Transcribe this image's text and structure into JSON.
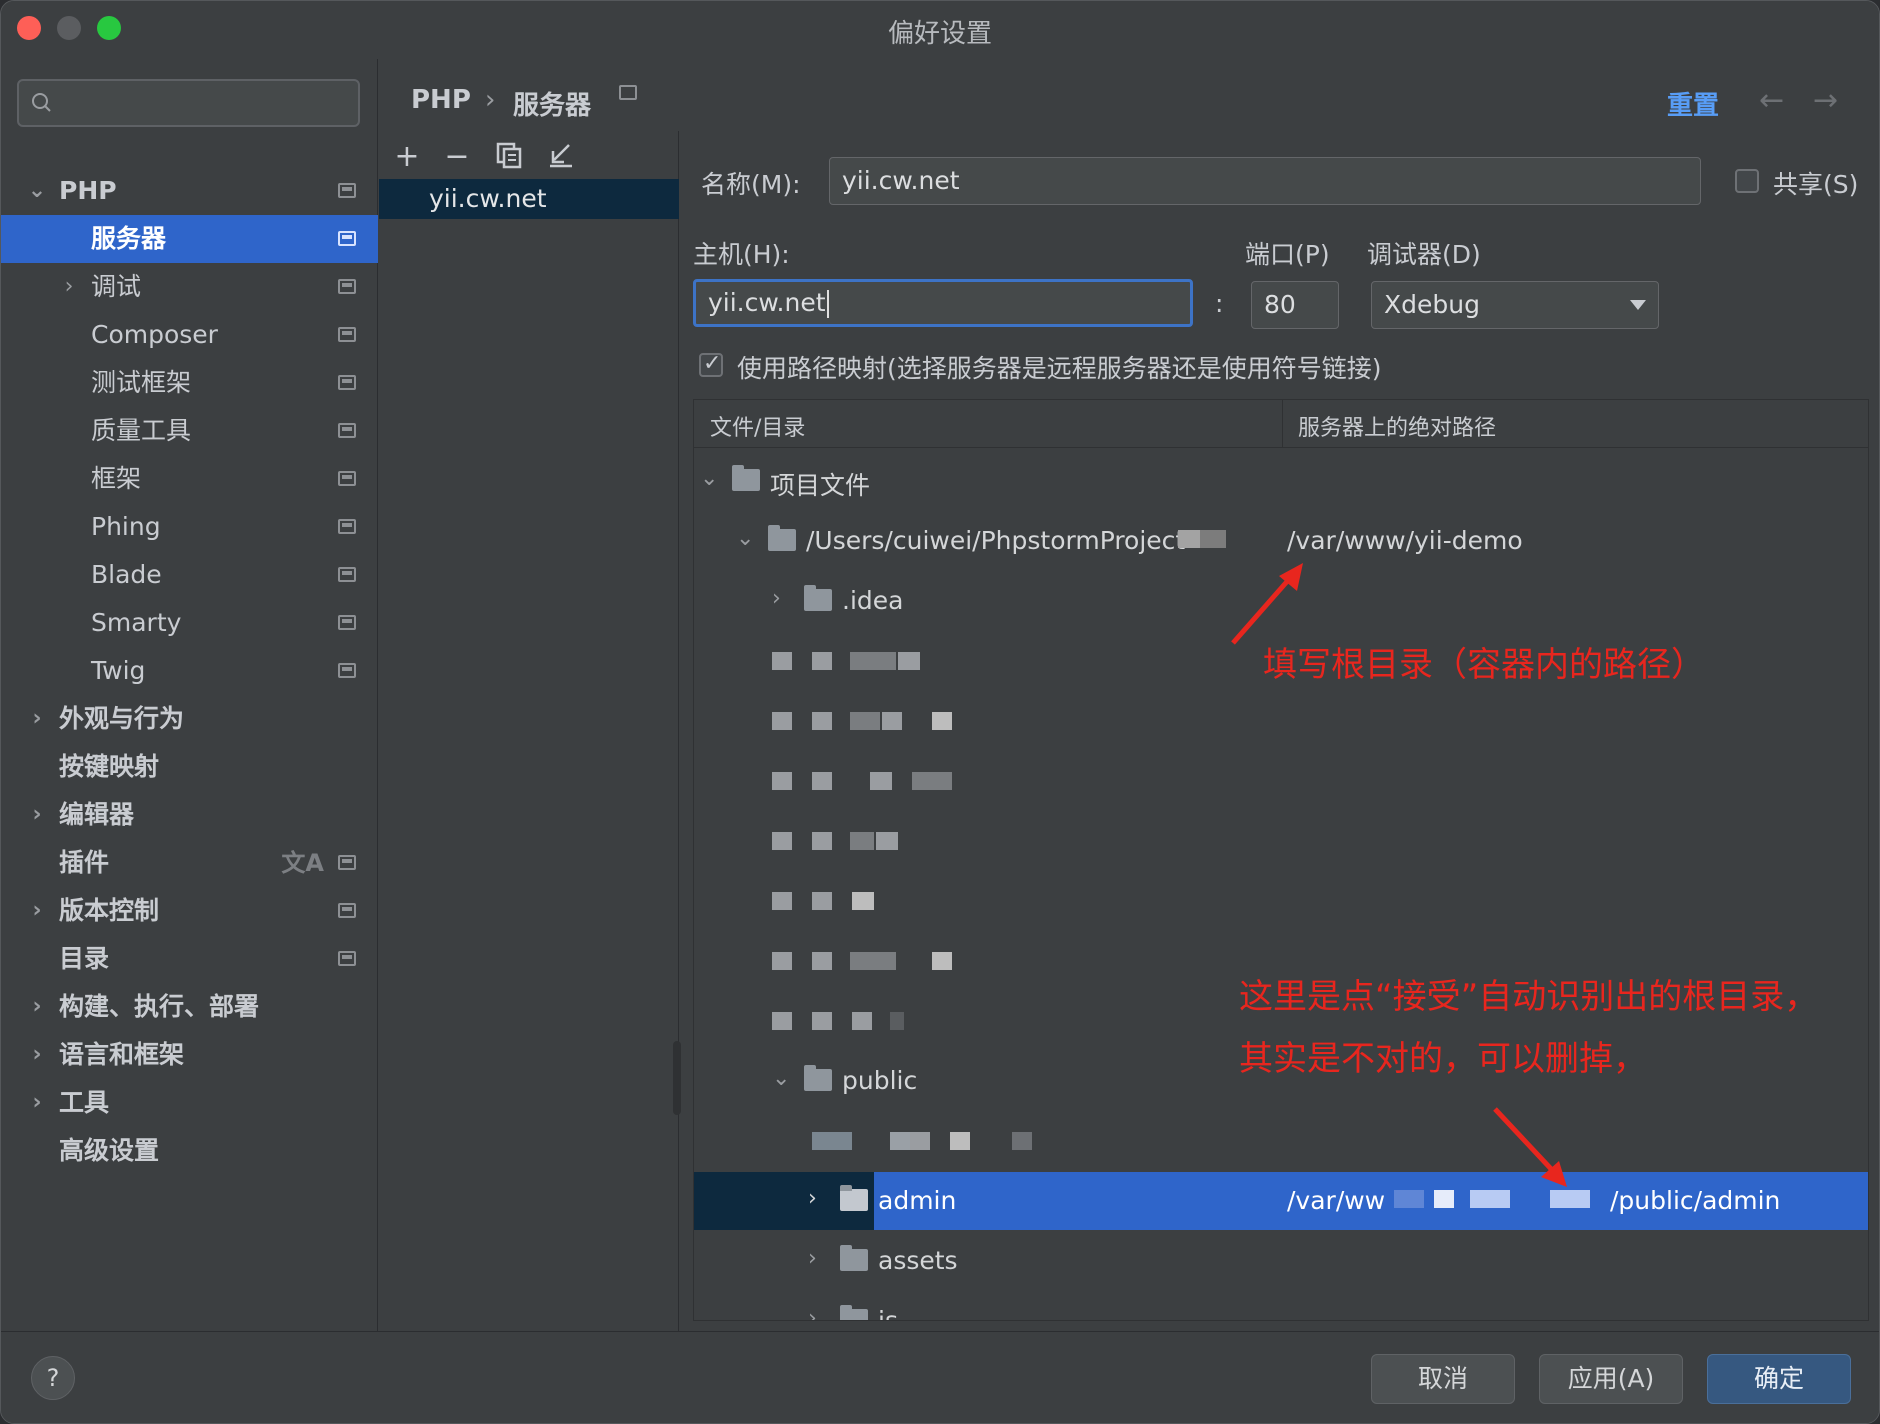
{
  "window": {
    "title": "偏好设置"
  },
  "search": {
    "placeholder": ""
  },
  "sidebar": {
    "items": [
      {
        "label": "PHP"
      },
      {
        "label": "服务器"
      },
      {
        "label": "调试"
      },
      {
        "label": "Composer"
      },
      {
        "label": "测试框架"
      },
      {
        "label": "质量工具"
      },
      {
        "label": "框架"
      },
      {
        "label": "Phing"
      },
      {
        "label": "Blade"
      },
      {
        "label": "Smarty"
      },
      {
        "label": "Twig"
      },
      {
        "label": "外观与行为"
      },
      {
        "label": "按键映射"
      },
      {
        "label": "编辑器"
      },
      {
        "label": "插件"
      },
      {
        "label": "版本控制"
      },
      {
        "label": "目录"
      },
      {
        "label": "构建、执行、部署"
      },
      {
        "label": "语言和框架"
      },
      {
        "label": "工具"
      },
      {
        "label": "高级设置"
      }
    ]
  },
  "breadcrumb": {
    "root": "PHP",
    "sep": "›",
    "current": "服务器"
  },
  "header": {
    "reset": "重置",
    "back": "←",
    "forward": "→"
  },
  "server_list": {
    "items": [
      "yii.cw.net"
    ]
  },
  "form": {
    "name_label": "名称(M):",
    "name_value": "yii.cw.net",
    "share_label": "共享(S)",
    "host_label": "主机(H):",
    "host_value": "yii.cw.net",
    "colon": ":",
    "port_label": "端口(P)",
    "port_value": "80",
    "debugger_label": "调试器(D)",
    "debugger_value": "Xdebug",
    "mapping_checkbox": "使用路径映射(选择服务器是远程服务器还是使用符号链接)"
  },
  "table": {
    "col_file": "文件/目录",
    "col_server": "服务器上的绝对路径",
    "rows": {
      "project_files": "项目文件",
      "project_path": "/Users/cuiwei/PhpstormProject",
      "project_server_path": "/var/www/yii-demo",
      "idea": ".idea",
      "public": "public",
      "admin": "admin",
      "admin_server_path_start": "/var/ww",
      "admin_server_path_end": "/public/admin",
      "assets": "assets",
      "js": "js"
    }
  },
  "annotations": {
    "root_hint": "填写根目录（容器内的路径）",
    "auto_hint_line1": "这里是点“接受”自动识别出的根目录，",
    "auto_hint_line2": "其实是不对的，可以删掉，",
    "color": "#e8261e"
  },
  "footer": {
    "help": "?",
    "cancel": "取消",
    "apply": "应用(A)",
    "ok": "确定"
  }
}
